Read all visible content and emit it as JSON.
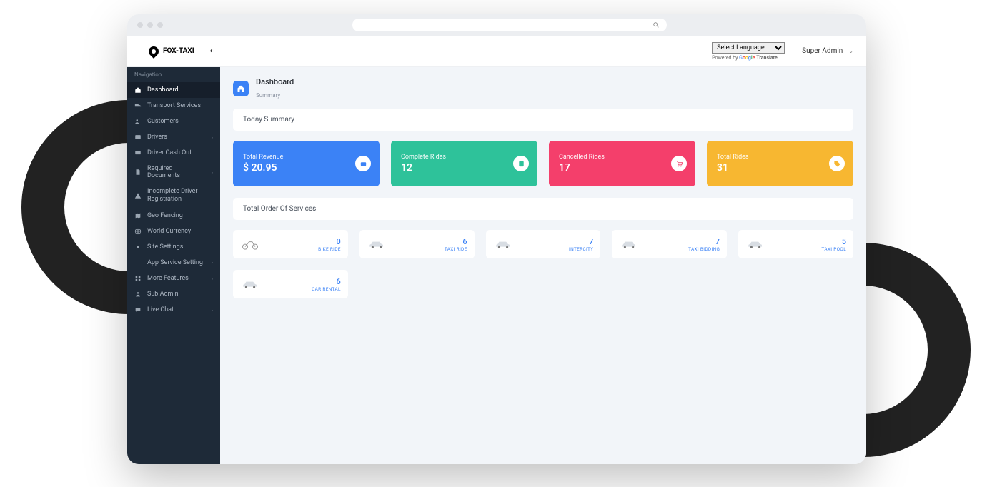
{
  "brand": "FOX-TAXI",
  "language_select": "Select Language",
  "powered_by": "Powered by",
  "translate_word": "Translate",
  "user_name": "Super Admin",
  "nav_title": "Navigation",
  "sidebar": [
    {
      "label": "Dashboard",
      "icon": "home",
      "active": true
    },
    {
      "label": "Transport Services",
      "icon": "truck"
    },
    {
      "label": "Customers",
      "icon": "users"
    },
    {
      "label": "Drivers",
      "icon": "id",
      "arrow": true
    },
    {
      "label": "Driver Cash Out",
      "icon": "cash"
    },
    {
      "label": "Required Documents",
      "icon": "doc",
      "arrow": true
    },
    {
      "label": "Incomplete Driver Registration",
      "icon": "warn"
    },
    {
      "label": "Geo Fencing",
      "icon": "map"
    },
    {
      "label": "World Currency",
      "icon": "globe"
    },
    {
      "label": "Site Settings",
      "icon": "gear"
    },
    {
      "label": "App Service Setting",
      "icon": "tools",
      "arrow": true
    },
    {
      "label": "More Features",
      "icon": "grid",
      "arrow": true
    },
    {
      "label": "Sub Admin",
      "icon": "user"
    },
    {
      "label": "Live Chat",
      "icon": "chat",
      "arrow": true
    }
  ],
  "page_title": "Dashboard",
  "page_subtitle": "Summary",
  "today_summary": "Today Summary",
  "stats": [
    {
      "label": "Total Revenue",
      "value": "$ 20.95",
      "color": "c-blue",
      "icon": "wallet"
    },
    {
      "label": "Complete Rides",
      "value": "12",
      "color": "c-green",
      "icon": "check"
    },
    {
      "label": "Cancelled Rides",
      "value": "17",
      "color": "c-red",
      "icon": "cart"
    },
    {
      "label": "Total Rides",
      "value": "31",
      "color": "c-orange",
      "icon": "tag"
    }
  ],
  "total_order": "Total Order Of Services",
  "services": [
    {
      "count": "0",
      "name": "BIKE RIDE",
      "veh": "bike"
    },
    {
      "count": "6",
      "name": "TAXI RIDE",
      "veh": "car"
    },
    {
      "count": "7",
      "name": "INTERCITY",
      "veh": "car"
    },
    {
      "count": "7",
      "name": "TAXI BIDDING",
      "veh": "car"
    },
    {
      "count": "5",
      "name": "TAXI POOL",
      "veh": "car"
    },
    {
      "count": "6",
      "name": "CAR RENTAL",
      "veh": "car"
    }
  ]
}
